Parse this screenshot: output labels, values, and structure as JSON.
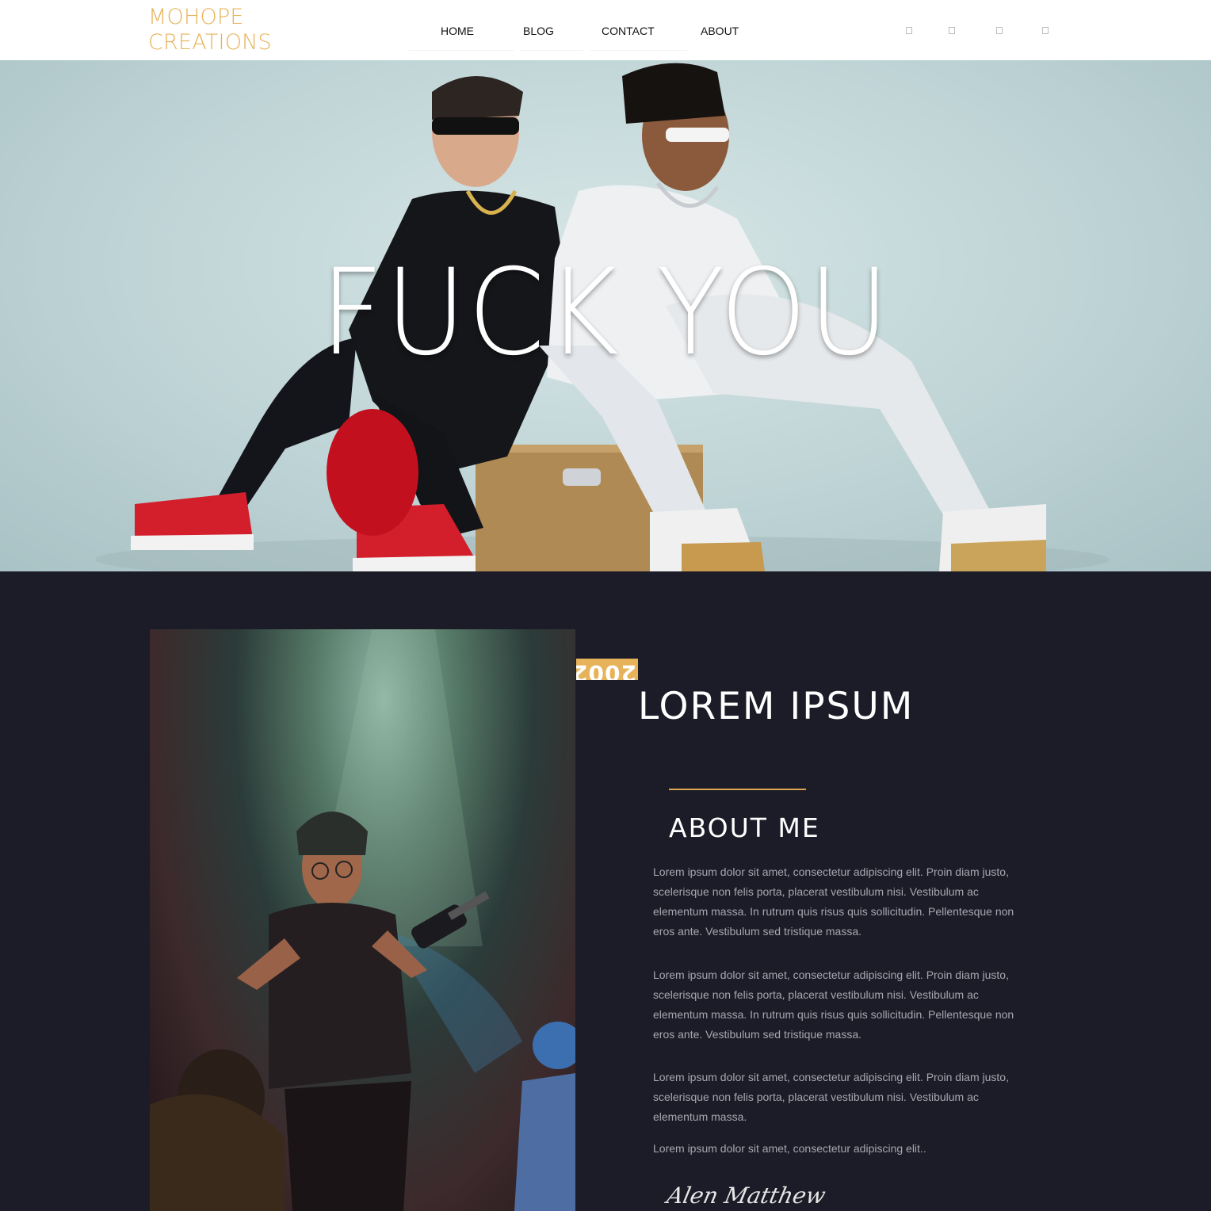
{
  "header": {
    "logo_line1": "MOHOPE",
    "logo_line2": "CREATIONS",
    "nav": {
      "home": "HOME",
      "blog": "BLOG",
      "contact": "CONTACT",
      "about": "ABOUT"
    },
    "social_icons": [
      "square-icon",
      "square-icon",
      "square-icon",
      "square-icon"
    ]
  },
  "hero": {
    "title": "FUCK YOU"
  },
  "about": {
    "tag_text": "2002",
    "headline": "LOREM IPSUM",
    "title": "ABOUT ME",
    "paragraphs": [
      "Lorem ipsum dolor sit amet, consectetur adipiscing elit. Proin diam justo, scelerisque non felis porta, placerat vestibulum nisi. Vestibulum ac elementum massa. In rutrum quis risus quis sollicitudin. Pellentesque non eros ante. Vestibulum sed tristique massa.",
      "Lorem ipsum dolor sit amet, consectetur adipiscing elit. Proin diam justo, scelerisque non felis porta, placerat vestibulum nisi. Vestibulum ac elementum massa. In rutrum quis risus quis sollicitudin. Pellentesque non eros ante. Vestibulum sed tristique massa.",
      "Lorem ipsum dolor sit amet, consectetur adipiscing elit. Proin diam justo, scelerisque non felis porta, placerat vestibulum nisi. Vestibulum ac elementum massa.",
      "Lorem ipsum dolor sit amet, consectetur adipiscing elit.."
    ],
    "signature": "Alen Matthew"
  },
  "colors": {
    "accent": "#e7b35a",
    "dark_bg": "#1c1c28",
    "body_text": "#a7a7b0"
  }
}
